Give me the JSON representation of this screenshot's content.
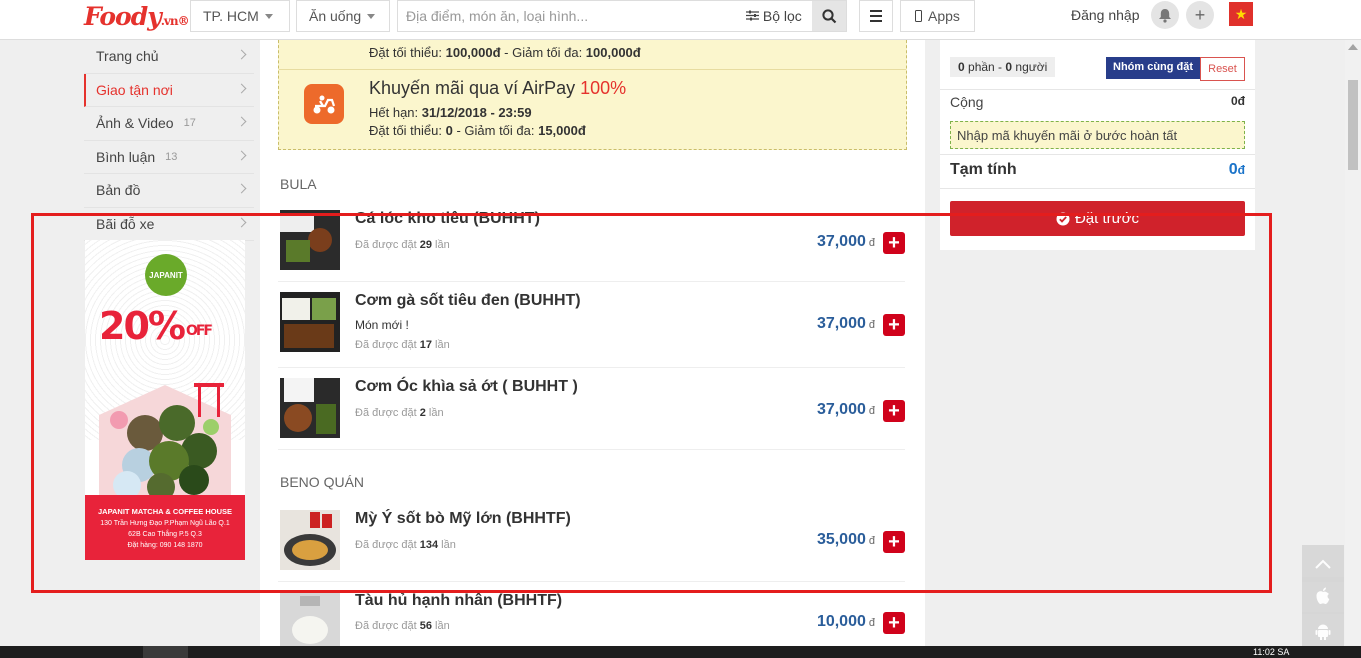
{
  "header": {
    "logo_text": "Foody",
    "logo_suffix": ".vn",
    "city": "TP. HCM",
    "category": "Ăn uống",
    "search_placeholder": "Địa điểm, món ăn, loại hình...",
    "filter_label": "Bộ lọc",
    "apps_label": "Apps",
    "login_label": "Đăng nhập"
  },
  "sidebar": {
    "items": [
      {
        "label": "Trang chủ",
        "count": ""
      },
      {
        "label": "Giao tận nơi",
        "count": ""
      },
      {
        "label": "Ảnh & Video",
        "count": "17"
      },
      {
        "label": "Bình luận",
        "count": "13"
      },
      {
        "label": "Bản đồ",
        "count": ""
      },
      {
        "label": "Bãi đỗ xe",
        "count": ""
      }
    ],
    "ad": {
      "brand": "JAPANIT",
      "discount": "20%",
      "discount_suffix": "OFF",
      "name": "JAPANIT MATCHA & COFFEE HOUSE",
      "address1": "130 Trần Hưng Đạo P.Phạm Ngũ Lão Q.1",
      "address2": "62B Cao Thắng P.5 Q.3",
      "phone": "Đặt hàng: 090 148 1870"
    }
  },
  "promos": {
    "first_line_prefix": "Đặt tối thiểu: ",
    "first_min": "100,000đ",
    "first_mid": " - Giảm tối đa: ",
    "first_max": "100,000đ",
    "airpay_title": "Khuyến mãi qua ví AirPay",
    "airpay_pct": "100%",
    "airpay_exp_label": "Hết hạn: ",
    "airpay_exp": "31/12/2018 - 23:59",
    "airpay_min_label": "Đặt tối thiểu: ",
    "airpay_min": "0",
    "airpay_max_label": " - Giảm tối đa: ",
    "airpay_max": "15,000đ"
  },
  "sections": [
    {
      "title": "BULA",
      "items": [
        {
          "name": "Cá lóc kho tiêu (BUHHT)",
          "desc": "",
          "count_prefix": "Đã được đặt ",
          "count": "29",
          "count_suffix": " lần",
          "price": "37,000",
          "unit": "đ"
        },
        {
          "name": "Cơm gà sốt tiêu đen (BUHHT)",
          "desc": "Món mới !",
          "count_prefix": "Đã được đặt ",
          "count": "17",
          "count_suffix": " lần",
          "price": "37,000",
          "unit": "đ"
        },
        {
          "name": "Cơm Óc khìa sả ớt ( BUHHT )",
          "desc": "",
          "count_prefix": "Đã được đặt ",
          "count": "2",
          "count_suffix": " lần",
          "price": "37,000",
          "unit": "đ"
        }
      ]
    },
    {
      "title": "BENO QUÁN",
      "items": [
        {
          "name": "Mỳ Ý sốt bò Mỹ lớn (BHHTF)",
          "desc": "",
          "count_prefix": "Đã được đặt ",
          "count": "134",
          "count_suffix": " lần",
          "price": "35,000",
          "unit": "đ"
        },
        {
          "name": "Tàu hủ hạnh nhân (BHHTF)",
          "desc": "",
          "count_prefix": "Đã được đặt ",
          "count": "56",
          "count_suffix": " lần",
          "price": "10,000",
          "unit": "đ"
        }
      ]
    }
  ],
  "cart": {
    "portions": "0",
    "portions_label": " phần - ",
    "people": "0",
    "people_label": " người",
    "group_button": "Nhóm cùng đặt",
    "reset_button": "Reset",
    "subtotal_label": "Cộng",
    "subtotal_value": "0đ",
    "coupon_text": "Nhập mã khuyến mãi ở bước hoàn tất",
    "total_label": "Tạm tính",
    "total_value": "0",
    "total_unit": "đ",
    "order_button": "Đặt trước"
  },
  "taskbar": {
    "clock": "11:02 SA"
  },
  "colors": {
    "brand": "#e5322d",
    "price": "#2a5d9a",
    "order": "#d0222b",
    "promo_bg": "#fbf6cd"
  }
}
